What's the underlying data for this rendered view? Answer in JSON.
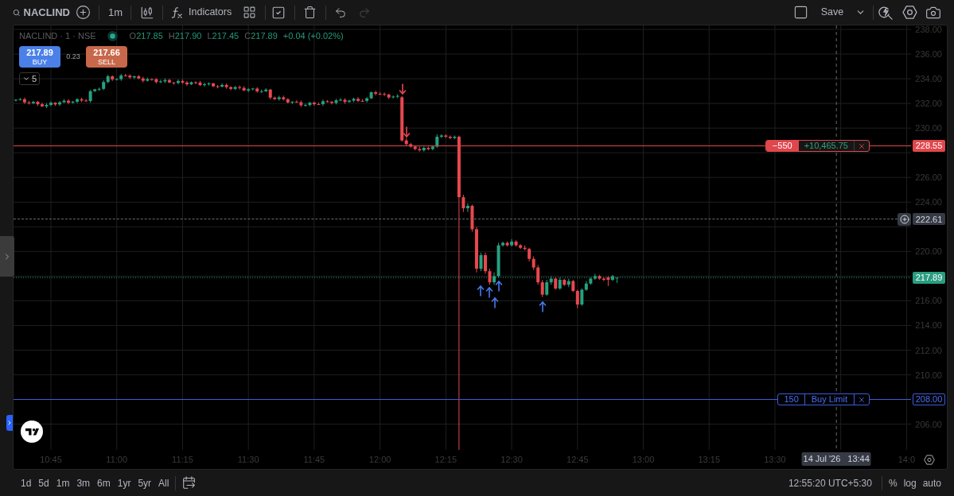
{
  "toolbar": {
    "symbol": "NACLIND",
    "interval": "1m",
    "indicators": "Indicators",
    "undo": {
      "disabled": false
    },
    "redo": {
      "disabled": true
    },
    "save": "Save"
  },
  "legend": {
    "title": "NACLIND · 1 · NSE",
    "market_open": true,
    "ohlc": [
      {
        "key": "O",
        "value": "217.85"
      },
      {
        "key": "H",
        "value": "217.90"
      },
      {
        "key": "L",
        "value": "217.45"
      },
      {
        "key": "C",
        "value": "217.89"
      }
    ],
    "change": "+0.04 (+0.02%)"
  },
  "trade": {
    "buy": {
      "price": "217.89",
      "label": "BUY"
    },
    "spread": "0.23",
    "sell": {
      "price": "217.66",
      "label": "SELL"
    }
  },
  "indicators_toggle": {
    "count": "5",
    "expanded": false
  },
  "price_axis": {
    "ticks": [
      "238.00",
      "236.00",
      "234.00",
      "232.00",
      "230.00",
      "226.00",
      "224.00",
      "220.00",
      "216.00",
      "214.00",
      "212.00",
      "210.00",
      "206.00"
    ]
  },
  "order_lines": [
    {
      "kind": "position",
      "quantity": "−550",
      "pnl": "+10,465.75",
      "price": "228.55"
    },
    {
      "kind": "limit",
      "quantity": "150",
      "label": "Buy Limit",
      "price": "208.00"
    }
  ],
  "crosshair": {
    "price": "222.61",
    "date": "14 Jul '26",
    "time": "13:44"
  },
  "last_price": "217.89",
  "time_axis": {
    "ticks": [
      "10:45",
      "11:00",
      "11:15",
      "11:30",
      "11:45",
      "12:00",
      "12:15",
      "12:30",
      "12:45",
      "13:00",
      "13:15",
      "13:30",
      "14:0"
    ]
  },
  "ranges": [
    "1d",
    "5d",
    "1m",
    "3m",
    "6m",
    "1yr",
    "5yr",
    "All"
  ],
  "status": {
    "clock": "12:55:20 UTC+5:30",
    "options": [
      "%",
      "log",
      "auto"
    ]
  }
}
